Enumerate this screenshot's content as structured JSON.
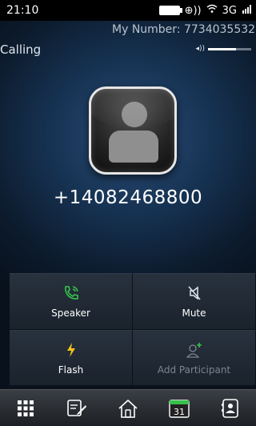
{
  "status": {
    "time": "21:10",
    "network": "3G"
  },
  "my_number": "My Number: 7734035532",
  "call": {
    "state": "Calling",
    "number": "+14082468800",
    "volume_level": 0.65
  },
  "actions": [
    {
      "label": "Speaker",
      "icon": "speakerphone-icon",
      "enabled": true
    },
    {
      "label": "Mute",
      "icon": "mute-icon",
      "enabled": true
    },
    {
      "label": "Flash",
      "icon": "flash-icon",
      "enabled": true
    },
    {
      "label": "Add Participant",
      "icon": "add-participant-icon",
      "enabled": false
    }
  ],
  "dock": {
    "items": [
      "dialpad-icon",
      "notes-icon",
      "home-icon",
      "calendar-icon",
      "contacts-icon"
    ],
    "calendar_day": "31"
  },
  "colors": {
    "accent_green": "#36c24a",
    "flash_yellow": "#f2c21a",
    "disabled_text": "#7b8591"
  }
}
